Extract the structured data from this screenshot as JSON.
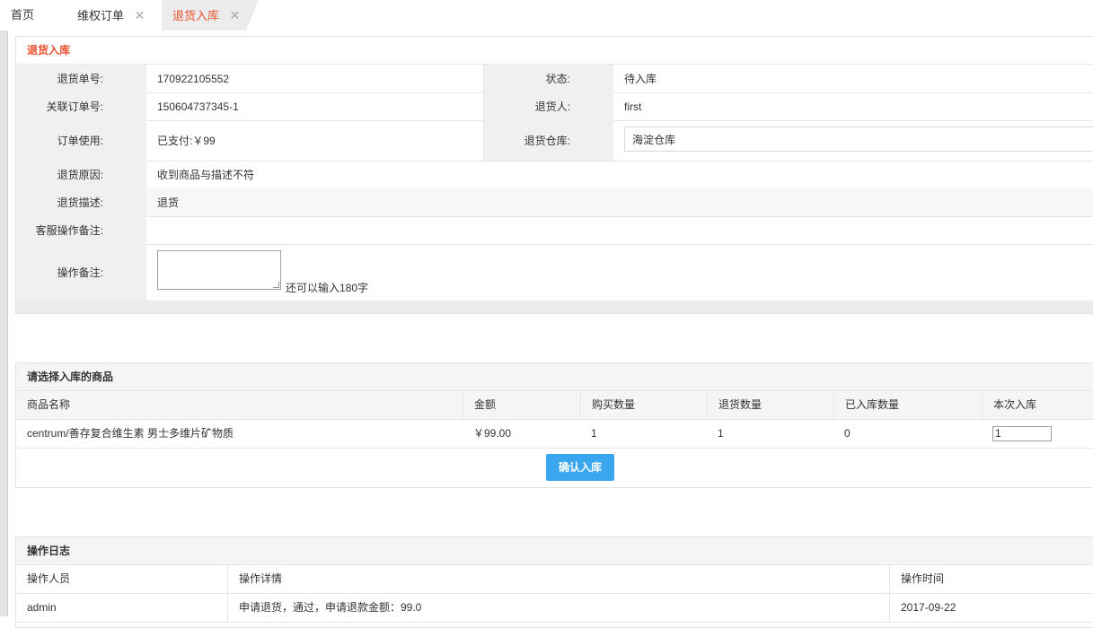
{
  "tabs": {
    "home": "首页",
    "orders": "维权订单",
    "return_inbound": "退货入库",
    "close_glyph": "✕"
  },
  "return_panel": {
    "title": "退货入库",
    "fields": {
      "return_no_label": "退货单号:",
      "return_no": "170922105552",
      "status_label": "状态:",
      "status": "待入库",
      "order_no_label": "关联订单号:",
      "order_no": "150604737345-1",
      "returner_label": "退货人:",
      "returner": "first",
      "order_usage_label": "订单使用:",
      "order_usage": "已支付:￥99",
      "warehouse_label": "退货仓库:",
      "warehouse": "海淀仓库",
      "reason_label": "退货原因:",
      "reason": "收到商品与描述不符",
      "description_label": "退货描述:",
      "description": "退货",
      "cs_remark_label": "客服操作备注:",
      "cs_remark": "",
      "op_remark_label": "操作备注:",
      "op_remark_value": "",
      "op_remark_hint": "还可以输入180字"
    }
  },
  "goods_panel": {
    "title": "请选择入库的商品",
    "columns": [
      "商品名称",
      "金额",
      "购买数量",
      "退货数量",
      "已入库数量",
      "本次入库"
    ],
    "rows": [
      {
        "name": "centrum/善存复合维生素 男士多维片矿物质",
        "amount": "￥99.00",
        "purchased": "1",
        "returned": "1",
        "stocked": "0",
        "this_inbound": "1"
      }
    ],
    "confirm_label": "确认入库"
  },
  "log_panel": {
    "title": "操作日志",
    "columns": [
      "操作人员",
      "操作详情",
      "操作时间"
    ],
    "rows": [
      {
        "operator": "admin",
        "detail": "申请退货，通过，申请退款金额：99.0",
        "time": "2017-09-22"
      }
    ]
  },
  "colors": {
    "accent": "#e8502e",
    "button": "#3aa6f0",
    "label_bg": "#f0f0f0"
  }
}
